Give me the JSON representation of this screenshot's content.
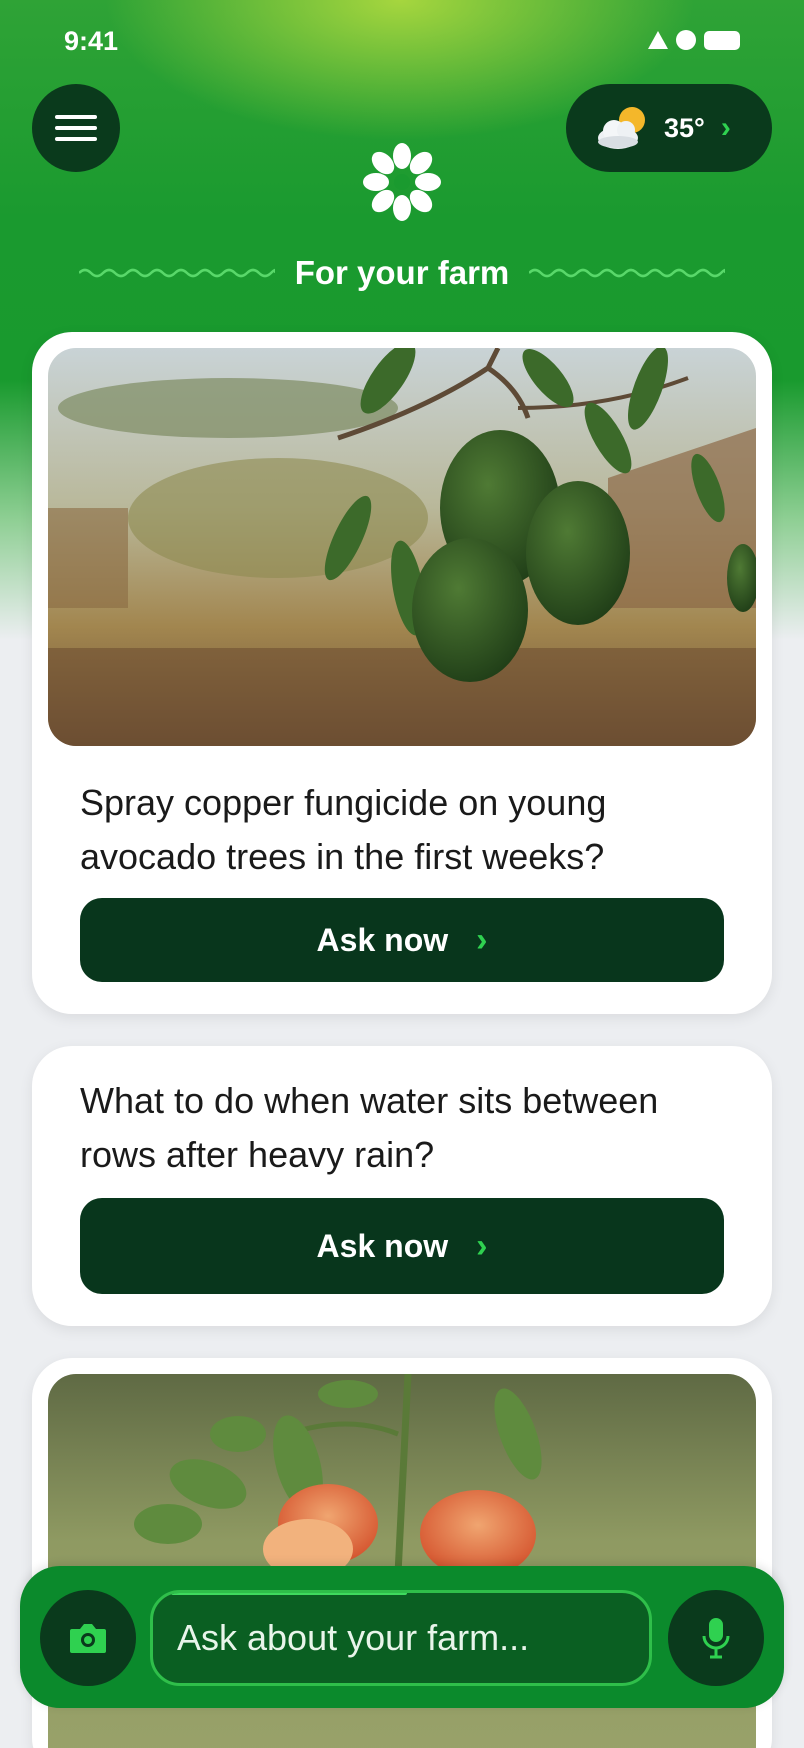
{
  "status_bar": {
    "time": "9:41"
  },
  "header": {
    "menu_icon": "hamburger-menu-icon",
    "weather": {
      "icon": "partly-cloudy-icon",
      "temperature": "35°",
      "chevron": "›"
    },
    "logo_icon": "flower-logo-icon",
    "section_title": "For your farm"
  },
  "cards": [
    {
      "image": "avocado-tree-photo",
      "question": "Spray copper fungicide on young avocado trees in the first weeks?",
      "button_label": "Ask now",
      "button_chevron": "›"
    },
    {
      "question": "What to do when water sits between rows after heavy rain?",
      "button_label": "Ask now",
      "button_chevron": "›"
    },
    {
      "image": "tomato-plant-photo"
    }
  ],
  "bottom_bar": {
    "camera_icon": "camera-icon",
    "input_placeholder": "Ask about your farm...",
    "mic_icon": "microphone-icon"
  },
  "colors": {
    "brand_green": "#1a9a2f",
    "dark_green": "#08361c",
    "accent_green": "#2fd150"
  }
}
